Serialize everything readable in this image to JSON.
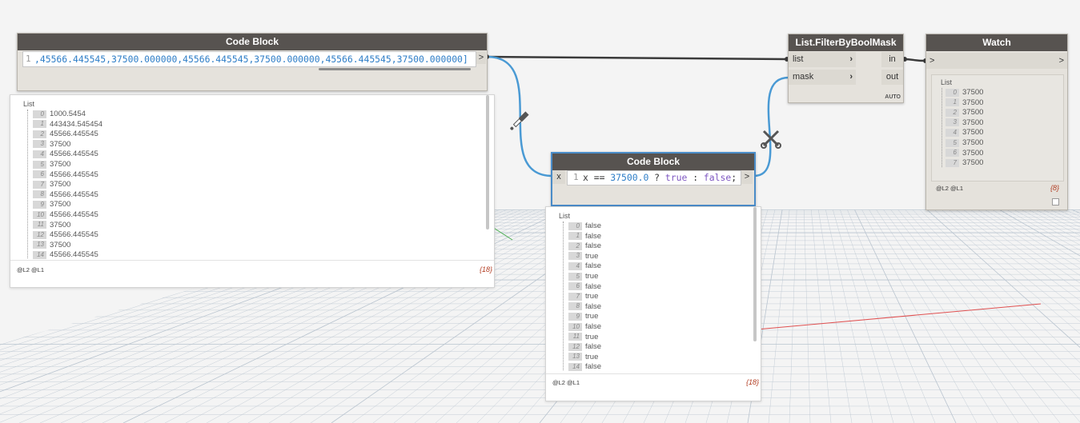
{
  "code_block_1": {
    "title": "Code Block",
    "line_number": "1",
    "code": ",45566.445545,37500.000000,45566.445545,37500.000000,45566.445545,37500.000000]",
    "out_port": ">"
  },
  "code_block_2": {
    "title": "Code Block",
    "in_port": "x",
    "line_number": "1",
    "code_x": "x ==",
    "code_num": "37500.0",
    "code_q": "?",
    "code_true": "true",
    "code_colon": ":",
    "code_false": "false",
    "code_semi": ";",
    "out_port": ">"
  },
  "filter_node": {
    "title": "List.FilterByBoolMask",
    "in_list": "list",
    "in_mask": "mask",
    "out_in": "in",
    "out_out": "out",
    "lacing": "AUTO"
  },
  "watch_node": {
    "title": "Watch",
    "in_port": ">",
    "out_port": ">",
    "preview": {
      "header": "List",
      "items": [
        {
          "i": "0",
          "v": "37500"
        },
        {
          "i": "1",
          "v": "37500"
        },
        {
          "i": "2",
          "v": "37500"
        },
        {
          "i": "3",
          "v": "37500"
        },
        {
          "i": "4",
          "v": "37500"
        },
        {
          "i": "5",
          "v": "37500"
        },
        {
          "i": "6",
          "v": "37500"
        },
        {
          "i": "7",
          "v": "37500"
        }
      ],
      "levels": "@L2 @L1",
      "count": "{8}"
    }
  },
  "preview_1": {
    "header": "List",
    "items": [
      {
        "i": "0",
        "v": "1000.5454"
      },
      {
        "i": "1",
        "v": "443434.545454"
      },
      {
        "i": "2",
        "v": "45566.445545"
      },
      {
        "i": "3",
        "v": "37500"
      },
      {
        "i": "4",
        "v": "45566.445545"
      },
      {
        "i": "5",
        "v": "37500"
      },
      {
        "i": "6",
        "v": "45566.445545"
      },
      {
        "i": "7",
        "v": "37500"
      },
      {
        "i": "8",
        "v": "45566.445545"
      },
      {
        "i": "9",
        "v": "37500"
      },
      {
        "i": "10",
        "v": "45566.445545"
      },
      {
        "i": "11",
        "v": "37500"
      },
      {
        "i": "12",
        "v": "45566.445545"
      },
      {
        "i": "13",
        "v": "37500"
      },
      {
        "i": "14",
        "v": "45566.445545"
      }
    ],
    "levels": "@L2 @L1",
    "count": "{18}"
  },
  "preview_2": {
    "header": "List",
    "items": [
      {
        "i": "0",
        "v": "false"
      },
      {
        "i": "1",
        "v": "false"
      },
      {
        "i": "2",
        "v": "false"
      },
      {
        "i": "3",
        "v": "true"
      },
      {
        "i": "4",
        "v": "false"
      },
      {
        "i": "5",
        "v": "true"
      },
      {
        "i": "6",
        "v": "false"
      },
      {
        "i": "7",
        "v": "true"
      },
      {
        "i": "8",
        "v": "false"
      },
      {
        "i": "9",
        "v": "true"
      },
      {
        "i": "10",
        "v": "false"
      },
      {
        "i": "11",
        "v": "true"
      },
      {
        "i": "12",
        "v": "false"
      },
      {
        "i": "13",
        "v": "true"
      },
      {
        "i": "14",
        "v": "false"
      }
    ],
    "levels": "@L2 @L1",
    "count": "{18}"
  },
  "colors": {
    "wire_selected": "#4a9ad4",
    "wire": "#3a3a3a",
    "grid": "#b9c4cf",
    "axis_red": "#e05050",
    "axis_green": "#4caf50",
    "code_number": "#2d7dc7",
    "code_keyword": "#7e57c2",
    "count": "#b1391e"
  },
  "icons": [
    "pick-wire-icon",
    "scissors-icon",
    "chevron-right-icon",
    "checkbox-icon"
  ]
}
